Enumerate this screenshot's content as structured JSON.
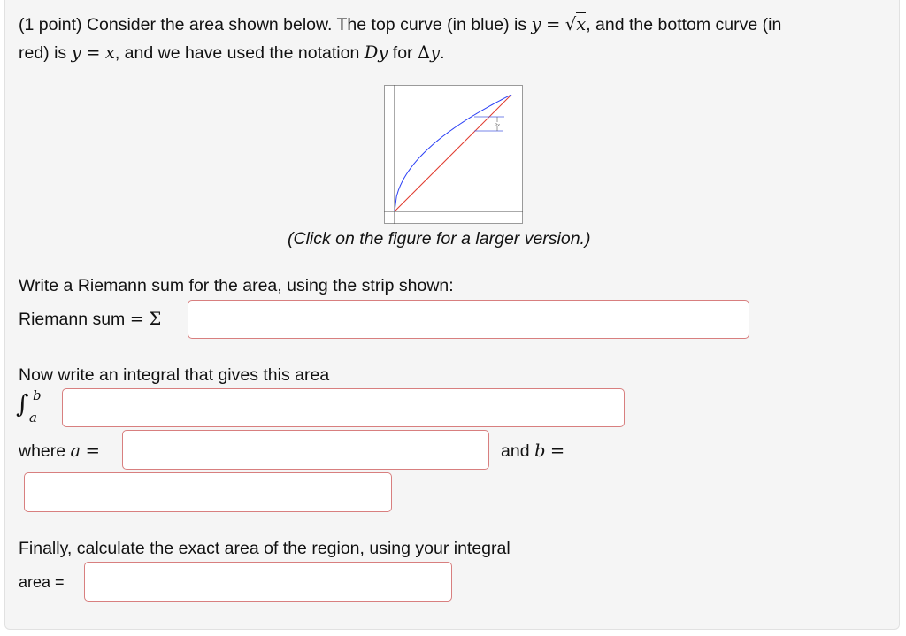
{
  "problem": {
    "line1_pre": "(1 point) Consider the area shown below. The top curve (in blue) is",
    "top_curve_lhs": "y",
    "eq": "=",
    "top_curve_radicand": "x",
    "line1_post": ", and the bottom curve (in",
    "line2_pre": "red) is",
    "bottom_curve_lhs": "y",
    "bottom_curve_rhs": "x",
    "line2_mid": ", and we have used the notation",
    "notation": "Dy",
    "for_word": "for",
    "delta_symbol": "Δ",
    "delta_var": "y",
    "period": "."
  },
  "figure": {
    "caption": "(Click on the figure for a larger version.)",
    "strip_label": "Dy",
    "top_curve_color": "#2a3ff5",
    "bottom_curve_color": "#e03b2f"
  },
  "riemann": {
    "prompt": "Write a Riemann sum for the area, using the strip shown:",
    "label": "Riemann sum",
    "eq": "=",
    "sigma": "Σ",
    "value": ""
  },
  "integral": {
    "prompt": "Now write an integral that gives this area",
    "symbol": "∫",
    "upper": "b",
    "lower": "a",
    "value": ""
  },
  "bounds": {
    "where_label": "where",
    "a_var": "a",
    "eq": "=",
    "a_value": "",
    "and_label": "and",
    "b_var": "b",
    "b_value": ""
  },
  "area": {
    "prompt": "Finally, calculate the exact area of the region, using your integral",
    "label": "area =",
    "value": ""
  },
  "colors": {
    "input_border": "#d87f7f",
    "panel_bg": "#f5f5f5"
  }
}
